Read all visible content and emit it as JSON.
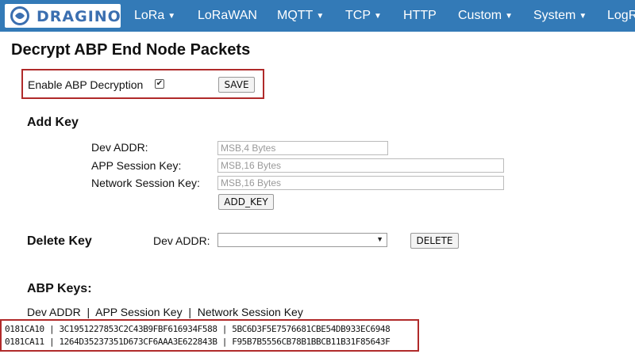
{
  "brand": {
    "logo_text": "DRAGINO"
  },
  "nav": {
    "items": [
      {
        "label": "LoRa",
        "caret": "▼"
      },
      {
        "label": "LoRaWAN",
        "caret": ""
      },
      {
        "label": "MQTT",
        "caret": "▼"
      },
      {
        "label": "TCP",
        "caret": "▼"
      },
      {
        "label": "HTTP",
        "caret": ""
      },
      {
        "label": "Custom",
        "caret": "▼"
      },
      {
        "label": "System",
        "caret": "▼"
      },
      {
        "label": "LogR",
        "caret": ""
      }
    ]
  },
  "page": {
    "title": "Decrypt ABP End Node Packets"
  },
  "decryption": {
    "enable_label": "Enable ABP Decryption",
    "enabled_mark": "✔",
    "save_label": "SAVE"
  },
  "add_key": {
    "heading": "Add Key",
    "dev_addr_label": "Dev ADDR:",
    "dev_addr_placeholder": "MSB,4 Bytes",
    "app_key_label": "APP Session Key:",
    "app_key_placeholder": "MSB,16 Bytes",
    "net_key_label": "Network Session Key:",
    "net_key_placeholder": "MSB,16 Bytes",
    "button_label": "ADD_KEY"
  },
  "delete_key": {
    "heading": "Delete Key",
    "dev_addr_label": "Dev ADDR:",
    "select_arrow": "▼",
    "button_label": "DELETE"
  },
  "abp_keys": {
    "heading": "ABP Keys:",
    "columns_header": "Dev ADDR  |  APP Session Key  |  Network Session Key",
    "rows": [
      "0181CA10 | 3C1951227853C2C43B9FBF616934F588 | 5BC6D3F5E7576681CBE54DB933EC6948",
      "0181CA11 | 1264D35237351D673CF6AAA3E622843B | F95B7B5556CB78B1BBCB11B31F85643F"
    ]
  }
}
